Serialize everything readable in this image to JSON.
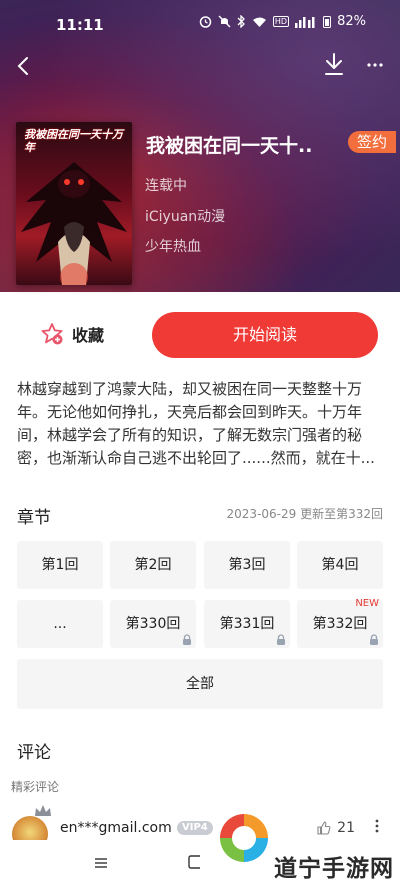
{
  "status_bar": {
    "time": "11:11",
    "battery": "82%",
    "hd_label": "HD"
  },
  "book": {
    "title": "我被困在同一天十..",
    "sign_badge": "签约",
    "status": "连载中",
    "publisher": "iCiyuan动漫",
    "category": "少年热血",
    "cover_text": "我被困在同一天十万年"
  },
  "actions": {
    "favorite_label": "收藏",
    "read_label": "开始阅读"
  },
  "synopsis": "林越穿越到了鸿蒙大陆，却又被困在同一天整整十万年。无论他如何挣扎，天亮后都会回到昨天。十万年间，林越学会了所有的知识，了解无数宗门强者的秘密，也渐渐认命自己逃不出轮回了......然而，就在十...",
  "chapters": {
    "title": "章节",
    "update_info": "2023-06-29 更新至第332回",
    "items": [
      {
        "label": "第1回",
        "locked": false,
        "new": false
      },
      {
        "label": "第2回",
        "locked": false,
        "new": false
      },
      {
        "label": "第3回",
        "locked": false,
        "new": false
      },
      {
        "label": "第4回",
        "locked": false,
        "new": false
      },
      {
        "label": "...",
        "locked": false,
        "new": false
      },
      {
        "label": "第330回",
        "locked": true,
        "new": false
      },
      {
        "label": "第331回",
        "locked": true,
        "new": false
      },
      {
        "label": "第332回",
        "locked": true,
        "new": true
      }
    ],
    "new_tag": "NEW",
    "all_label": "全部"
  },
  "comments": {
    "title": "评论",
    "subtitle": "精彩评论",
    "items": [
      {
        "user": "en***gmail.com",
        "vip": "VIP4",
        "likes": "21"
      }
    ]
  },
  "watermark": {
    "text": "道宁手游网"
  },
  "colors": {
    "accent": "#ef3a36",
    "sign_badge": "#f26e3c",
    "tile_bg": "#f5f5f5"
  },
  "icons": {
    "back": "back-arrow-icon",
    "download": "download-icon",
    "more": "more-dots-icon",
    "favorite": "star-plus-icon",
    "lock": "lock-icon",
    "like": "thumbs-up-icon"
  }
}
